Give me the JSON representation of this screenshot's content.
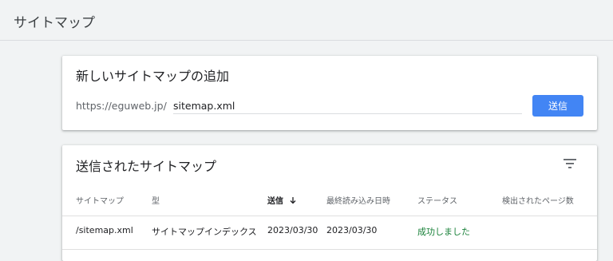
{
  "page": {
    "title": "サイトマップ"
  },
  "add_card": {
    "title": "新しいサイトマップの追加",
    "url_prefix": "https://eguweb.jp/",
    "input_value": "sitemap.xml",
    "submit_label": "送信"
  },
  "submitted_card": {
    "title": "送信されたサイトマップ",
    "columns": [
      {
        "label": "サイトマップ"
      },
      {
        "label": "型"
      },
      {
        "label": "送信",
        "sorted": true,
        "sort_dir": "desc"
      },
      {
        "label": "最終読み込み日時"
      },
      {
        "label": "ステータス"
      },
      {
        "label": "検出されたページ数"
      }
    ],
    "rows": [
      {
        "sitemap": "/sitemap.xml",
        "type": "サイトマップインデックス",
        "submitted": "2023/03/30",
        "last_read": "2023/03/30",
        "status": "成功しました",
        "status_color": "#188038",
        "pages": ""
      }
    ]
  },
  "colors": {
    "accent": "#4285f4",
    "success": "#188038",
    "background": "#f1f3f4"
  }
}
